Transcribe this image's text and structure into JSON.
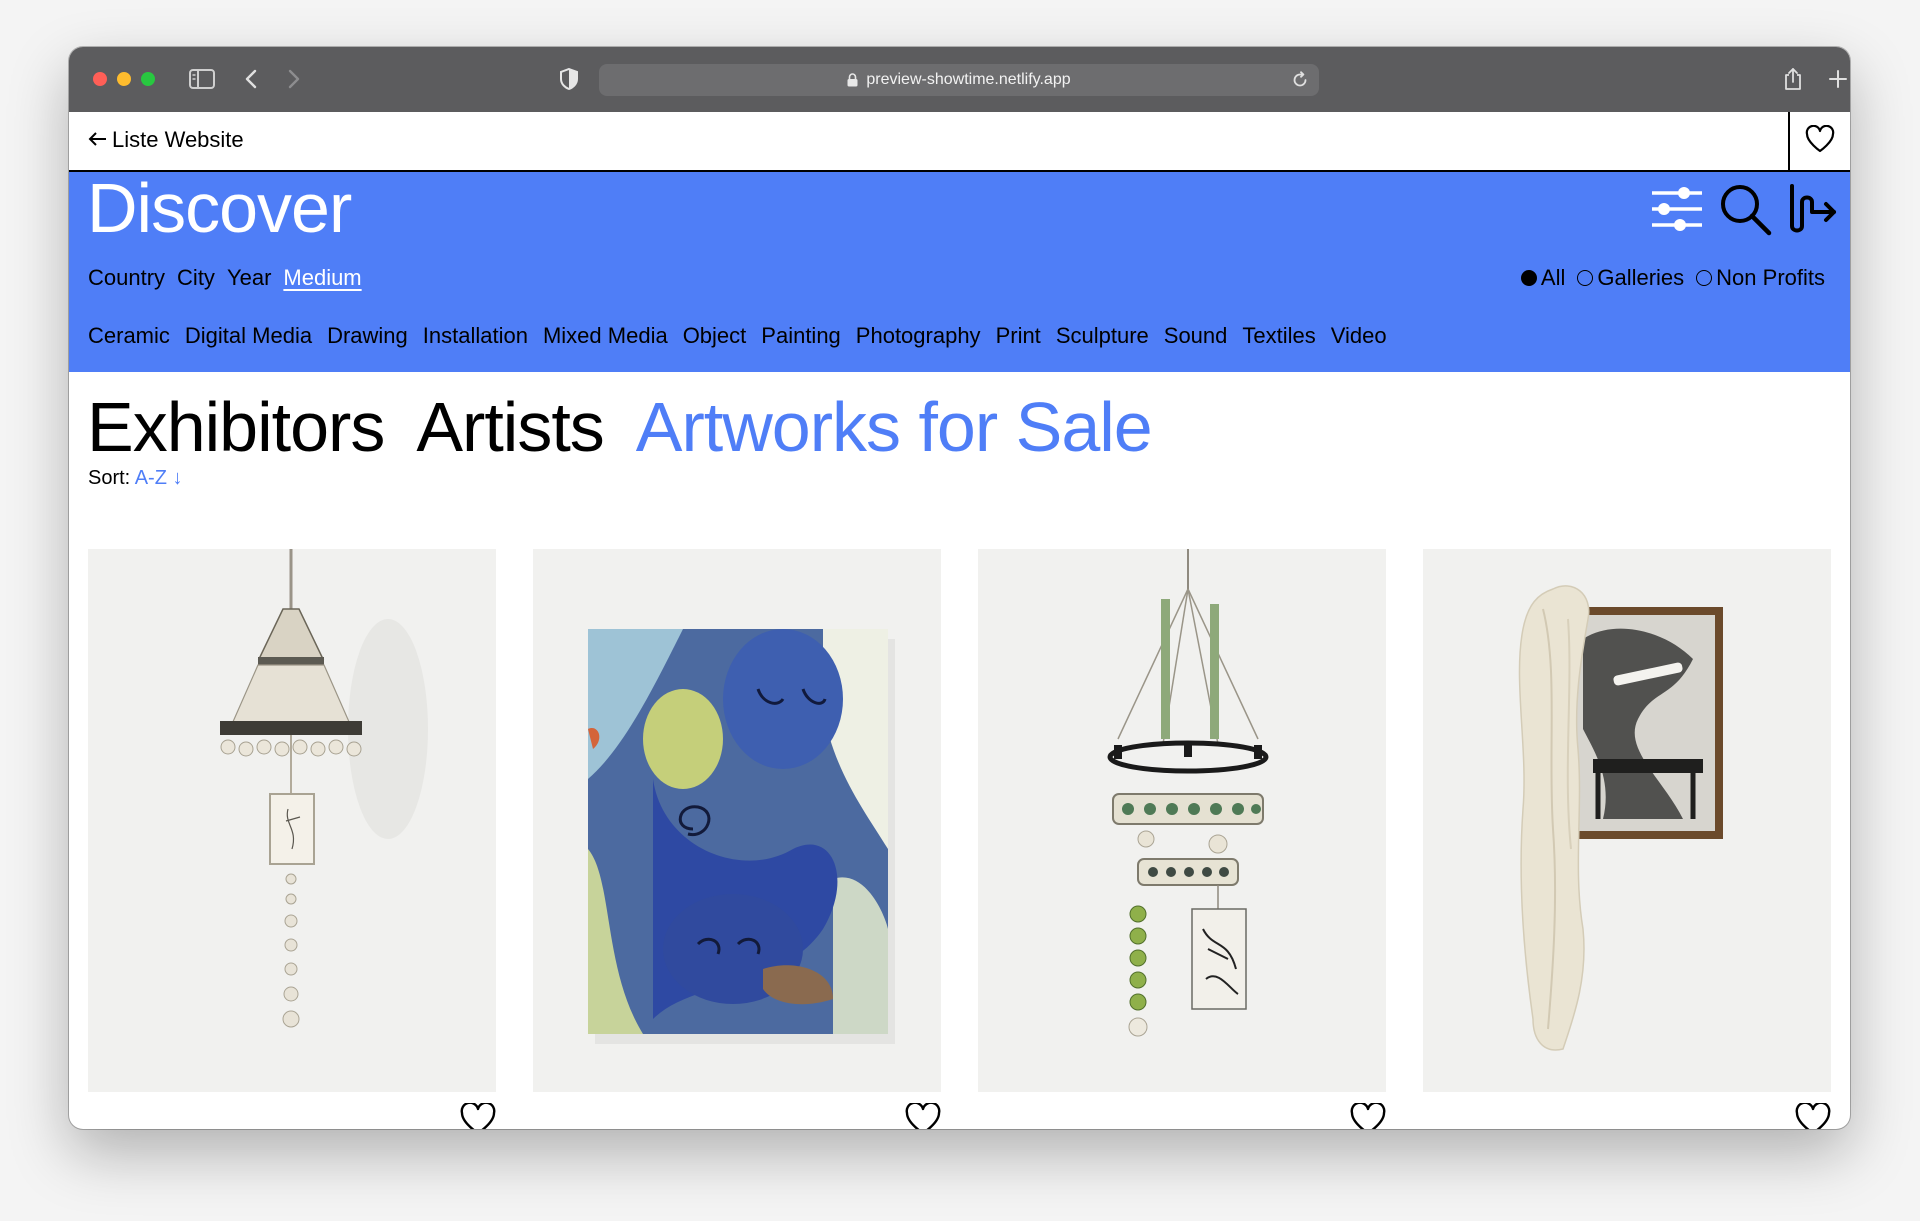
{
  "browser": {
    "url": "preview-showtime.netlify.app"
  },
  "topbar": {
    "back_label": "Liste Website"
  },
  "discover": {
    "title": "Discover",
    "filter_tabs": [
      "Country",
      "City",
      "Year",
      "Medium"
    ],
    "active_filter": "Medium",
    "type_options": [
      {
        "label": "All",
        "selected": true
      },
      {
        "label": "Galleries",
        "selected": false
      },
      {
        "label": "Non Profits",
        "selected": false
      }
    ],
    "mediums": [
      "Ceramic",
      "Digital Media",
      "Drawing",
      "Installation",
      "Mixed Media",
      "Object",
      "Painting",
      "Photography",
      "Print",
      "Sculpture",
      "Sound",
      "Textiles",
      "Video"
    ],
    "icons": [
      "sliders-icon",
      "search-icon",
      "arrow-squiggle-icon"
    ]
  },
  "main": {
    "tabs": [
      "Exhibitors",
      "Artists",
      "Artworks for Sale"
    ],
    "active_tab": "Artworks for Sale",
    "sort_label": "Sort:",
    "sort_value": "A-Z ↓"
  },
  "artworks": [
    {
      "kind": "hanging-lamp-sculpture"
    },
    {
      "kind": "blue-figures-painting"
    },
    {
      "kind": "hanging-chandelier-sculpture"
    },
    {
      "kind": "framed-drawing-with-cloth"
    }
  ],
  "colors": {
    "accent": "#4f7ef7",
    "chrome": "#5c5c5e"
  }
}
